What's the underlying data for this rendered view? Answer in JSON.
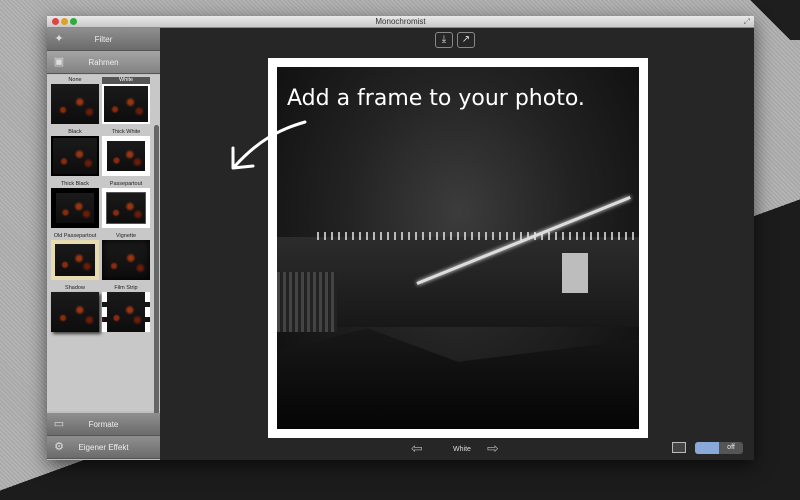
{
  "window": {
    "title": "Monochromist"
  },
  "sidebar": {
    "sections": [
      {
        "label": "Filter",
        "icon": "magic-wand-icon"
      },
      {
        "label": "Rahmen",
        "icon": "frame-icon"
      },
      {
        "label": "Formate",
        "icon": "formats-icon"
      },
      {
        "label": "Eigener Effekt",
        "icon": "custom-effect-icon"
      }
    ],
    "frames": [
      {
        "label": "None"
      },
      {
        "label": "White",
        "selected": true
      },
      {
        "label": "Black"
      },
      {
        "label": "Thick White"
      },
      {
        "label": "Thick Black"
      },
      {
        "label": "Passepartout"
      },
      {
        "label": "Old Passepartout"
      },
      {
        "label": "Vignette"
      },
      {
        "label": "Shadow"
      },
      {
        "label": "Film Strip"
      }
    ]
  },
  "main": {
    "caption": "Add a frame to your photo.",
    "current_frame": "White",
    "toolbar": {
      "save_icon": "save-download-icon",
      "share_icon": "share-icon"
    },
    "compare_toggle": {
      "state": "off"
    }
  }
}
